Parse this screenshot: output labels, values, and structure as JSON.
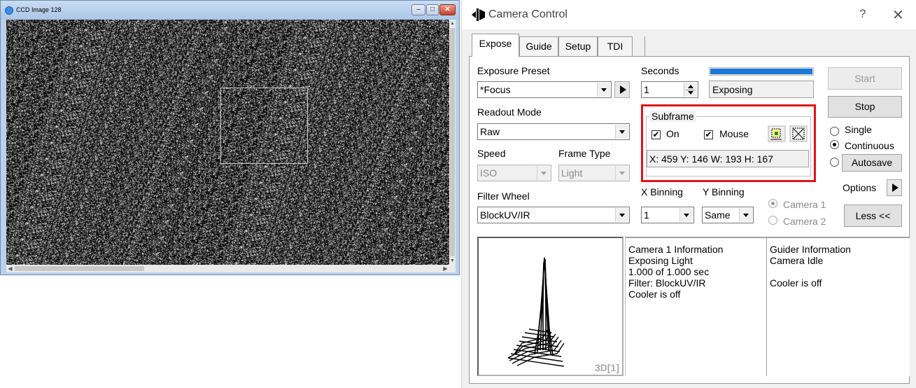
{
  "ccd_window": {
    "title": "CCD Image 128",
    "buttons": {
      "minimize": "–",
      "maximize": "□",
      "close": "✕"
    }
  },
  "dialog": {
    "title": "Camera Control",
    "help": "?",
    "close": "✕"
  },
  "tabs": [
    {
      "label": "Expose",
      "active": true
    },
    {
      "label": "Guide",
      "active": false
    },
    {
      "label": "Setup",
      "active": false
    },
    {
      "label": "TDI",
      "active": false
    }
  ],
  "expose": {
    "exposure_preset_label": "Exposure Preset",
    "exposure_preset_value": "*Focus",
    "seconds_label": "Seconds",
    "seconds_value": "1",
    "status_text": "Exposing",
    "progress": 1.0,
    "readout_mode_label": "Readout Mode",
    "readout_mode_value": "Raw",
    "speed_label": "Speed",
    "speed_value": "ISO",
    "frame_type_label": "Frame Type",
    "frame_type_value": "Light",
    "filter_wheel_label": "Filter Wheel",
    "filter_wheel_value": "BlockUV/IR",
    "x_binning_label": "X Binning",
    "x_binning_value": "1",
    "y_binning_label": "Y Binning",
    "y_binning_value": "Same"
  },
  "subframe": {
    "title": "Subframe",
    "on_label": "On",
    "on_checked": true,
    "mouse_label": "Mouse",
    "mouse_checked": true,
    "coords": "X: 459 Y: 146 W: 193 H: 167",
    "highlight_color": "#e0141c"
  },
  "buttons": {
    "start": "Start",
    "stop": "Stop",
    "autosave": "Autosave",
    "options": "Options",
    "less": "Less <<"
  },
  "mode": {
    "single": "Single",
    "continuous": "Continuous",
    "selected": "continuous"
  },
  "camera_select": {
    "camera1": "Camera 1",
    "camera2": "Camera 2",
    "selected": "camera1"
  },
  "plot": {
    "label": "3D[1]"
  },
  "camera_info": [
    "Camera 1 Information",
    "Exposing Light",
    "1.000 of 1.000 sec",
    "Filter: BlockUV/IR",
    "Cooler is off"
  ],
  "guider_info": [
    "Guider Information",
    "Camera Idle",
    "",
    "Cooler is off"
  ],
  "colors": {
    "progress": "#1b7ad8",
    "image_bg": "#0c0c0c",
    "dialog_bg": "#f0f0f0"
  }
}
